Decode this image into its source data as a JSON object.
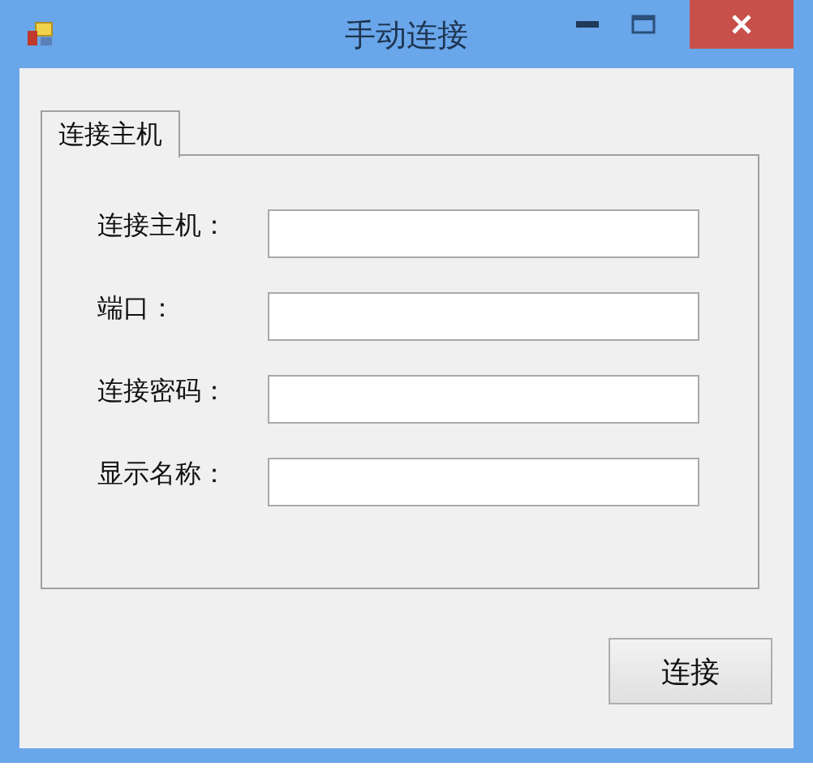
{
  "window": {
    "title": "手动连接"
  },
  "tabs": [
    {
      "label": "连接主机",
      "selected": true
    }
  ],
  "fields": [
    {
      "label": "连接主机："
    },
    {
      "label": "端口："
    },
    {
      "label": "连接密码："
    },
    {
      "label": "显示名称："
    }
  ],
  "buttons": [
    "连接"
  ]
}
